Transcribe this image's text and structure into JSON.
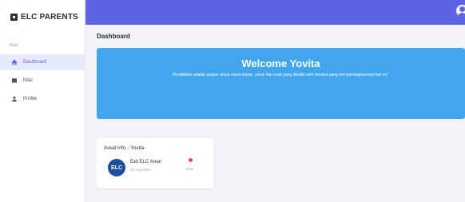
{
  "brand": {
    "name": "ELC PARENTS",
    "icon": "square-icon"
  },
  "sidebar": {
    "section_label": "Main",
    "items": [
      {
        "label": "Dashboard",
        "icon": "house-icon",
        "active": true
      },
      {
        "label": "Nilai",
        "icon": "book-icon",
        "active": false
      },
      {
        "label": "Profile",
        "icon": "user-icon",
        "active": false
      }
    ]
  },
  "header": {
    "avatar": "user-avatar-icon"
  },
  "main": {
    "title": "Dashboard",
    "banner": {
      "title": "Welcome Yovita",
      "quote": "Pendidikan adalah paspor untuk masa depan, untuk hari esok yang dimiliki oleh mereka yang mempersiapkannya hari ini.\""
    },
    "card": {
      "title": "Areal info - Yovita",
      "item": {
        "logo_text": "ELC",
        "name": "Exit ELC Areal",
        "date": "15-Aug-2022",
        "status": "Now"
      }
    }
  },
  "colors": {
    "accent": "#5e63e6",
    "banner": "#41a6ee",
    "status": "#f0456a",
    "logo": "#1a4f9c"
  }
}
